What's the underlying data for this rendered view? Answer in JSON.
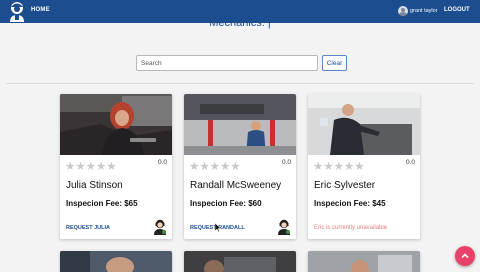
{
  "nav": {
    "home_label": "HOME",
    "user_name": "grant taylor",
    "logout_label": "LOGOUT"
  },
  "page": {
    "title": "Mechanics: |"
  },
  "search": {
    "placeholder": "Search",
    "value": "",
    "clear_label": "Clear"
  },
  "cards": [
    {
      "name": "Julia Stinson",
      "rating": "0.0",
      "fee": "Inspecion Fee: $65",
      "action": "REQUEST JULIA",
      "available": true,
      "stars": 5
    },
    {
      "name": "Randall McSweeney",
      "rating": "0.0",
      "fee": "Inspecion Fee: $60",
      "action": "REQUEST RANDALL",
      "available": true,
      "stars": 5
    },
    {
      "name": "Eric Sylvester",
      "rating": "0.0",
      "fee": "Inspecion Fee: $45",
      "unavailable_text": "Eric is currently unavailable",
      "available": false,
      "stars": 5
    }
  ],
  "colors": {
    "navbar": "#1b4d8f",
    "fab": "#e8426a",
    "unavailable": "#e07f7f",
    "star_empty": "#c8c8c8"
  },
  "icons": {
    "logo": "mechanic-logo-icon",
    "fab": "chevron-up-icon",
    "star": "star-icon",
    "mechanic": "mechanic-avatar-icon"
  }
}
